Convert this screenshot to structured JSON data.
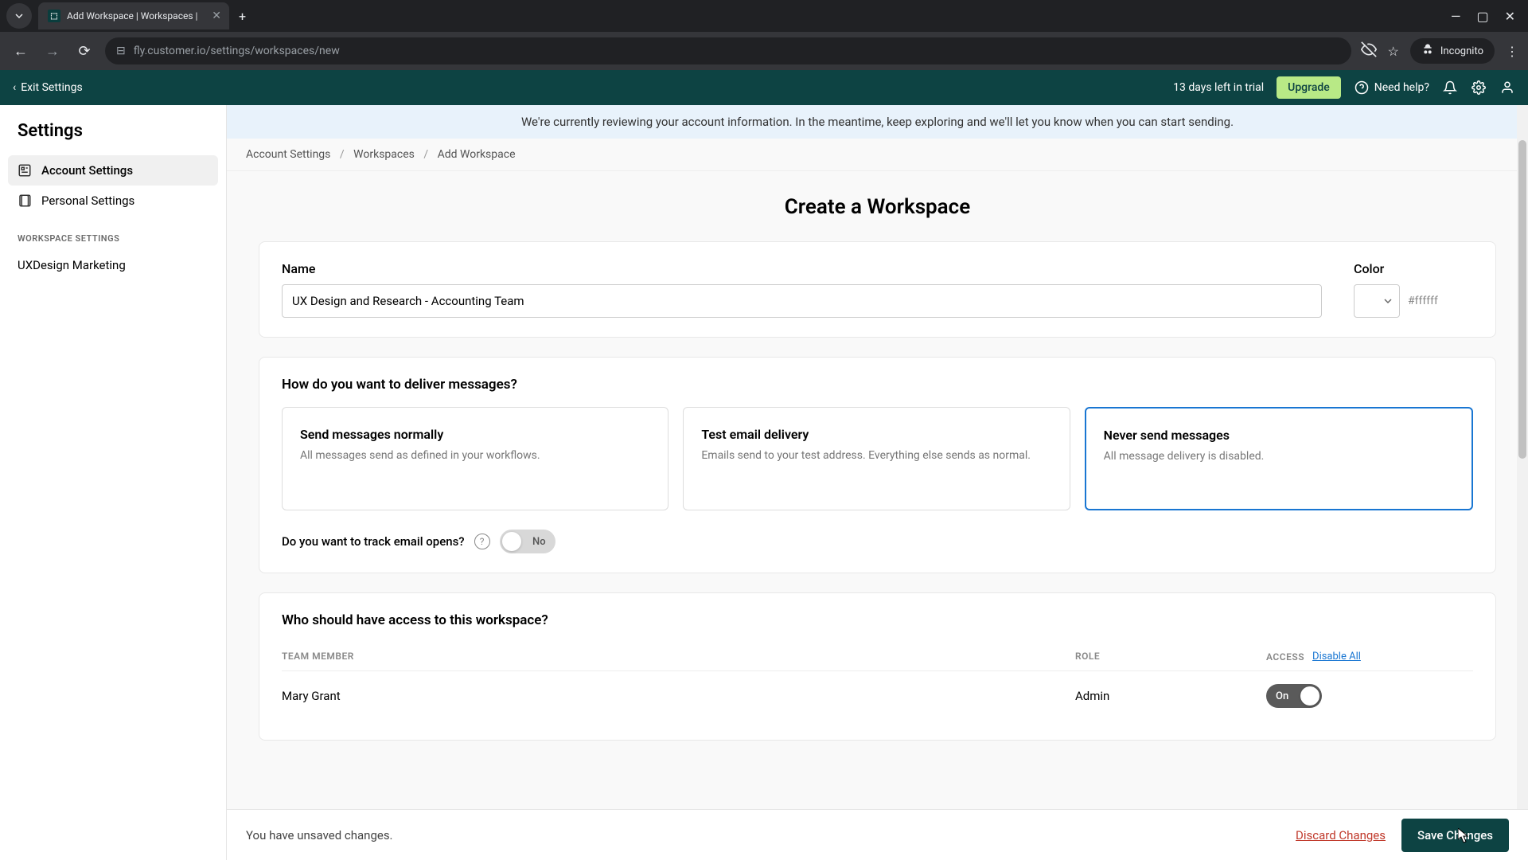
{
  "browser": {
    "tab_title": "Add Workspace | Workspaces |",
    "url": "fly.customer.io/settings/workspaces/new",
    "incognito": "Incognito"
  },
  "header": {
    "exit": "Exit Settings",
    "trial": "13 days left in trial",
    "upgrade": "Upgrade",
    "help": "Need help?"
  },
  "sidebar": {
    "title": "Settings",
    "items": [
      {
        "label": "Account Settings"
      },
      {
        "label": "Personal Settings"
      }
    ],
    "section": "WORKSPACE SETTINGS",
    "workspace": "UXDesign Marketing"
  },
  "banner": "We're currently reviewing your account information. In the meantime, keep exploring and we'll let you know when you can start sending.",
  "breadcrumb": {
    "a": "Account Settings",
    "b": "Workspaces",
    "c": "Add Workspace"
  },
  "page_title": "Create a Workspace",
  "form": {
    "name_label": "Name",
    "name_value": "UX Design and Research - Accounting Team",
    "color_label": "Color",
    "color_hex": "#ffffff"
  },
  "delivery": {
    "heading": "How do you want to deliver messages?",
    "options": [
      {
        "title": "Send messages normally",
        "desc": "All messages send as defined in your workflows."
      },
      {
        "title": "Test email delivery",
        "desc": "Emails send to your test address. Everything else sends as normal."
      },
      {
        "title": "Never send messages",
        "desc": "All message delivery is disabled."
      }
    ],
    "track_label": "Do you want to track email opens?",
    "track_value": "No"
  },
  "access": {
    "heading": "Who should have access to this workspace?",
    "col_member": "TEAM MEMBER",
    "col_role": "ROLE",
    "col_access": "ACCESS",
    "disable_all": "Disable All",
    "rows": [
      {
        "name": "Mary Grant",
        "role": "Admin",
        "access": "On"
      }
    ]
  },
  "footer": {
    "unsaved": "You have unsaved changes.",
    "discard": "Discard Changes",
    "save": "Save Changes"
  }
}
